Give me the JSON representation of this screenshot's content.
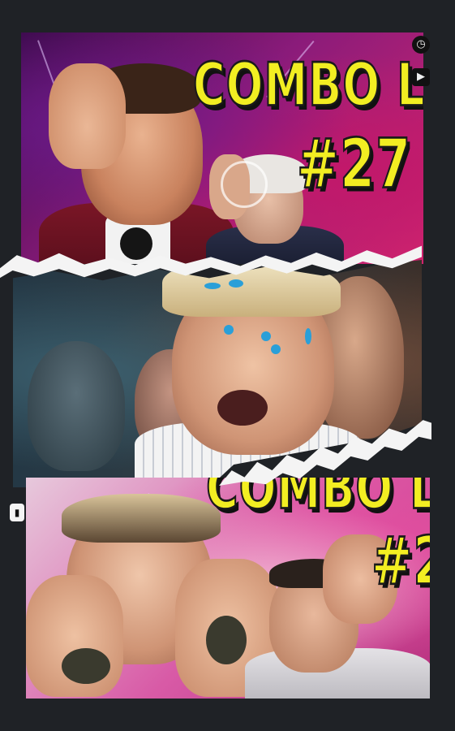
{
  "collage": {
    "top_panel": {
      "title": "COMBO LOCO",
      "number": "#27"
    },
    "bottom_panel": {
      "title": "COMBO LOCO",
      "number": "#2"
    },
    "icons": {
      "clock": "clock-icon",
      "play": "play-icon",
      "edge": "bookmark-icon"
    }
  }
}
